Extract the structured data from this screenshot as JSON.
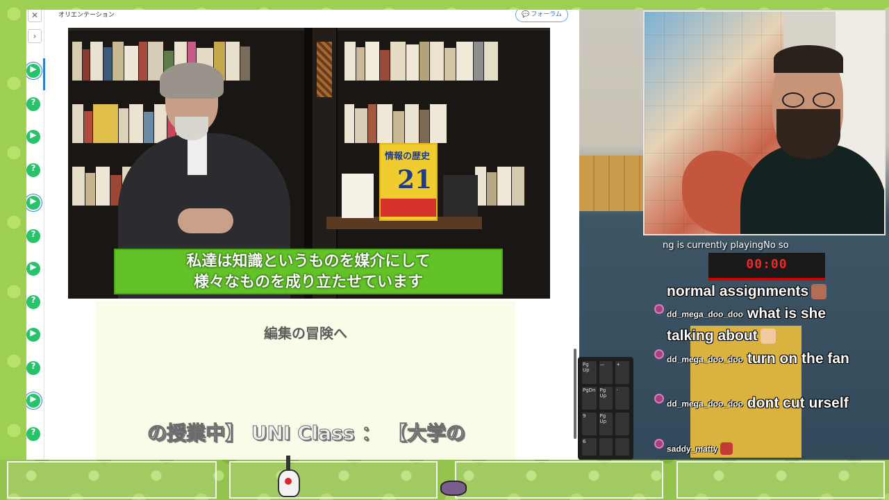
{
  "lms": {
    "nav": {
      "close_glyph": "✕",
      "next_glyph": "›",
      "steps": [
        {
          "glyph": "▶",
          "type": "video",
          "active": true
        },
        {
          "glyph": "?",
          "type": "quiz"
        },
        {
          "glyph": "▶",
          "type": "video"
        },
        {
          "glyph": "?",
          "type": "quiz"
        },
        {
          "glyph": "▶",
          "type": "video",
          "active": true
        },
        {
          "glyph": "?",
          "type": "quiz"
        },
        {
          "glyph": "▶",
          "type": "video"
        },
        {
          "glyph": "?",
          "type": "quiz"
        },
        {
          "glyph": "▶",
          "type": "video"
        },
        {
          "glyph": "?",
          "type": "quiz"
        },
        {
          "glyph": "▶",
          "type": "video",
          "active": true
        },
        {
          "glyph": "?",
          "type": "quiz"
        }
      ],
      "accent_color": "#27c36b"
    },
    "course_title": "オリエンテーション",
    "forum_button": {
      "icon": "speech-bubble-icon",
      "label": "フォーラム"
    },
    "video": {
      "subtitle_line1": "私達は知識というものを媒介にして",
      "subtitle_line2": "様々なものを成り立たせています",
      "subtitle_bg": "#62c227",
      "book_title": "情報の歴史",
      "book_number": "21"
    },
    "note_heading": "編集の冒険へ",
    "marquee_text": "の授業中】 UNI Class ： 【大学の"
  },
  "stream": {
    "now_playing": "ng is currently playingNo so",
    "timer": "00:00",
    "chat": [
      {
        "user": "",
        "message": "normal assignments",
        "emote": true,
        "emote_color": "#b36d55"
      },
      {
        "user": "dd_mega_doo_doo",
        "message": "what is she talking about",
        "emote": true,
        "emote_color": "#f1c9a0"
      },
      {
        "user": "dd_mega_doo_doo",
        "message": "turn on the fan",
        "emote": false
      },
      {
        "user": "dd_mega_doo_doo",
        "message": "dont cut urself",
        "emote": false
      },
      {
        "user": "saddy_matty",
        "message": "",
        "emote": true,
        "emote_color": "#c23b35"
      }
    ]
  },
  "keyboard_keys": [
    "Pg Up",
    "—",
    "+",
    "PgDn",
    "Pg Up",
    "·",
    "9",
    "Pg Up",
    "",
    "6",
    "",
    ""
  ]
}
